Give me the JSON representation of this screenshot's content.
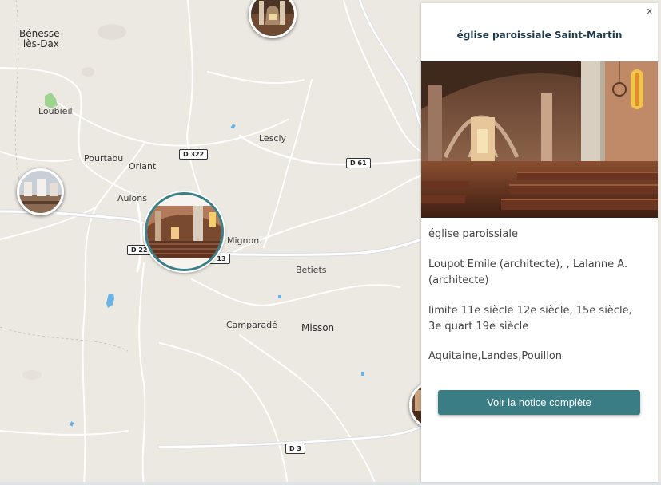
{
  "map": {
    "places": [
      {
        "id": "benesse",
        "lines": [
          "Bénesse-",
          "lès-Dax"
        ]
      },
      {
        "id": "loubieil",
        "lines": [
          "Loubieil"
        ]
      },
      {
        "id": "pourtaou",
        "lines": [
          "Pourtaou"
        ]
      },
      {
        "id": "oriant",
        "lines": [
          "Oriant"
        ]
      },
      {
        "id": "aulons",
        "lines": [
          "Aulons"
        ]
      },
      {
        "id": "mignon",
        "lines": [
          "Mignon"
        ]
      },
      {
        "id": "lescly",
        "lines": [
          "Lescly"
        ]
      },
      {
        "id": "betiets",
        "lines": [
          "Betiets"
        ]
      },
      {
        "id": "camparade",
        "lines": [
          "Camparadé"
        ]
      },
      {
        "id": "misson",
        "lines": [
          "Misson"
        ]
      }
    ],
    "roads": {
      "d322": "D 322",
      "d61": "D 61",
      "d22": "D 22",
      "d13": "D 13",
      "d3": "D 3"
    },
    "markers": [
      "church-marker-top",
      "church-marker-left",
      "church-marker-active",
      "church-marker-right"
    ]
  },
  "panel": {
    "close_label": "x",
    "title": "église paroissiale Saint-Martin",
    "type": "église paroissiale",
    "architects": "Loupot Emile (architecte), , Lalanne A. (architecte)",
    "period": "limite 11e siècle 12e siècle, 15e siècle, 3e quart 19e siècle",
    "location": "Aquitaine,Landes,Pouillon",
    "button_label": "Voir la notice complète"
  }
}
